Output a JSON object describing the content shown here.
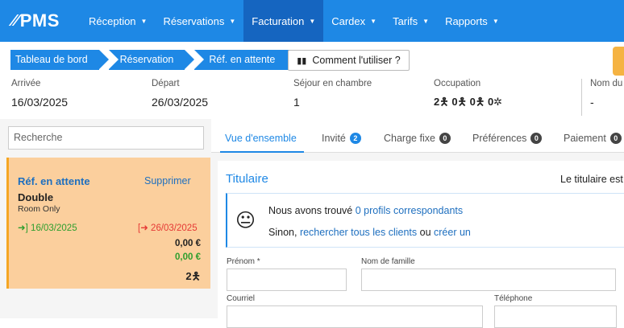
{
  "app": {
    "logo": "PMS"
  },
  "nav": {
    "items": [
      {
        "label": "Réception",
        "active": false
      },
      {
        "label": "Réservations",
        "active": false
      },
      {
        "label": "Facturation",
        "active": true
      },
      {
        "label": "Cardex",
        "active": false
      },
      {
        "label": "Tarifs",
        "active": false
      },
      {
        "label": "Rapports",
        "active": false
      }
    ]
  },
  "breadcrumb": [
    "Tableau de bord",
    "Réservation",
    "Réf. en attente"
  ],
  "howto_label": "Comment l'utiliser ?",
  "info": {
    "arrival": {
      "label": "Arrivée",
      "value": "16/03/2025"
    },
    "departure": {
      "label": "Départ",
      "value": "26/03/2025"
    },
    "stay": {
      "label": "Séjour en chambre",
      "value": "1"
    },
    "occupancy": {
      "label": "Occupation",
      "adults": "2",
      "children": "0",
      "babies": "0",
      "other": "0"
    },
    "name": {
      "label": "Nom du",
      "value": "-"
    }
  },
  "search": {
    "placeholder": "Recherche"
  },
  "card": {
    "title": "Réf. en attente",
    "delete_label": "Supprimer",
    "room_type": "Double",
    "rate_plan": "Room Only",
    "arrival": "16/03/2025",
    "departure": "26/03/2025",
    "amount_total": "0,00 €",
    "amount_paid": "0,00 €",
    "pax": "2"
  },
  "tabs": [
    {
      "label": "Vue d'ensemble",
      "badge": null
    },
    {
      "label": "Invité",
      "badge": "2"
    },
    {
      "label": "Charge fixe",
      "badge": "0"
    },
    {
      "label": "Préférences",
      "badge": "0"
    },
    {
      "label": "Paiement",
      "badge": "0"
    }
  ],
  "holder": {
    "title": "Titulaire",
    "right_text": "Le titulaire est",
    "found_prefix": "Nous avons trouvé",
    "found_link": "0 profils correspondants",
    "else_prefix": "Sinon,",
    "search_all_link": "rechercher tous les clients",
    "or_text": "ou",
    "create_link": "créer un"
  },
  "form": {
    "first_name_label": "Prénom *",
    "last_name_label": "Nom de famille",
    "email_label": "Courriel",
    "phone_label": "Téléphone"
  },
  "colors": {
    "primary": "#1e88e5",
    "active_nav": "#1565c0",
    "card_bg": "#fbcf9d",
    "green": "#2e9e2e",
    "red": "#e53935"
  }
}
